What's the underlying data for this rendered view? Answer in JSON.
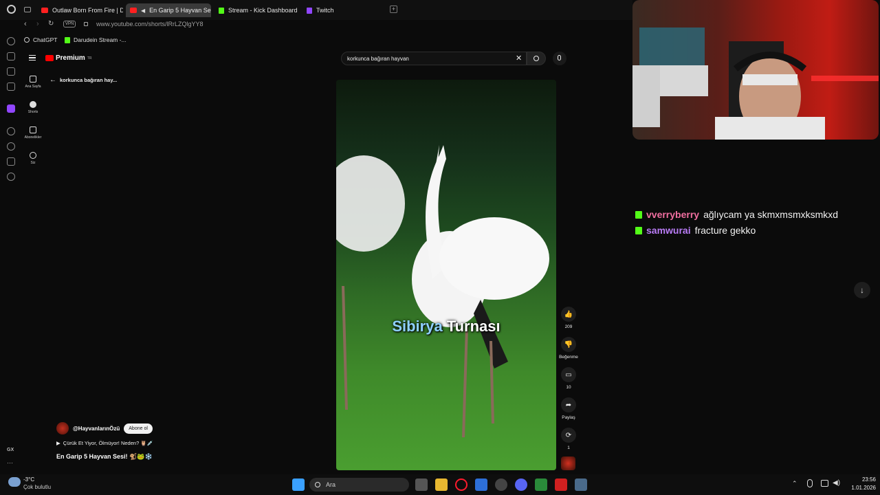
{
  "tabs": [
    {
      "label": "Outlaw Born From Fire | De",
      "icon": "youtube-icon"
    },
    {
      "label": "En Garip 5 Hayvan Se",
      "icon": "youtube-icon",
      "active": true
    },
    {
      "label": "Stream - Kick Dashboard",
      "icon": "kick-icon"
    },
    {
      "label": "Twitch",
      "icon": "twitch-icon"
    }
  ],
  "address": {
    "url": "www.youtube.com/shorts/lRrLZQlgYY8",
    "vpn": "VPN"
  },
  "bookmarks": [
    {
      "label": "ChatGPT"
    },
    {
      "label": "Darudein Stream -..."
    }
  ],
  "youtube": {
    "logo_text": "Premium",
    "logo_sup": "TR",
    "back_label": "korkunca bağıran hay...",
    "nav": [
      {
        "label": "Ana Sayfa",
        "icon": "home-icon"
      },
      {
        "label": "Shorts",
        "icon": "shorts-icon"
      },
      {
        "label": "Abonelikler",
        "icon": "subscriptions-icon"
      },
      {
        "label": "Siz",
        "icon": "account-icon"
      }
    ],
    "search_value": "korkunca bağıran hayvan",
    "caption_part1": "Sibirya",
    "caption_part2": " Turnası",
    "actions": {
      "like_count": "209",
      "dislike_label": "Beğenme",
      "comments_count": "10",
      "share_label": "Paylaş",
      "remix_count": "1"
    },
    "channel": "@HayvanlarınÖzü",
    "subscribe_label": "Abone ol",
    "playlist_line": "Çürük Et Yiyor, Ölmüyor! Neden? 🦉💉",
    "video_title": "En Garip 5 Hayvan Sesi! 🐒🐸❄️"
  },
  "chat": [
    {
      "user": "vverryberry",
      "color": "#f06fa0",
      "message": "ağlıycam ya skmxmsmxksmkxd"
    },
    {
      "user": "samwurai",
      "color": "#b97cf6",
      "message": "fracture gekko"
    }
  ],
  "taskbar": {
    "weather_temp": "-3°C",
    "weather_desc": "Çok bulutlu",
    "search_label": "Ara",
    "time": "23:56",
    "date": "1.01.2026"
  },
  "rail_label": "GX"
}
